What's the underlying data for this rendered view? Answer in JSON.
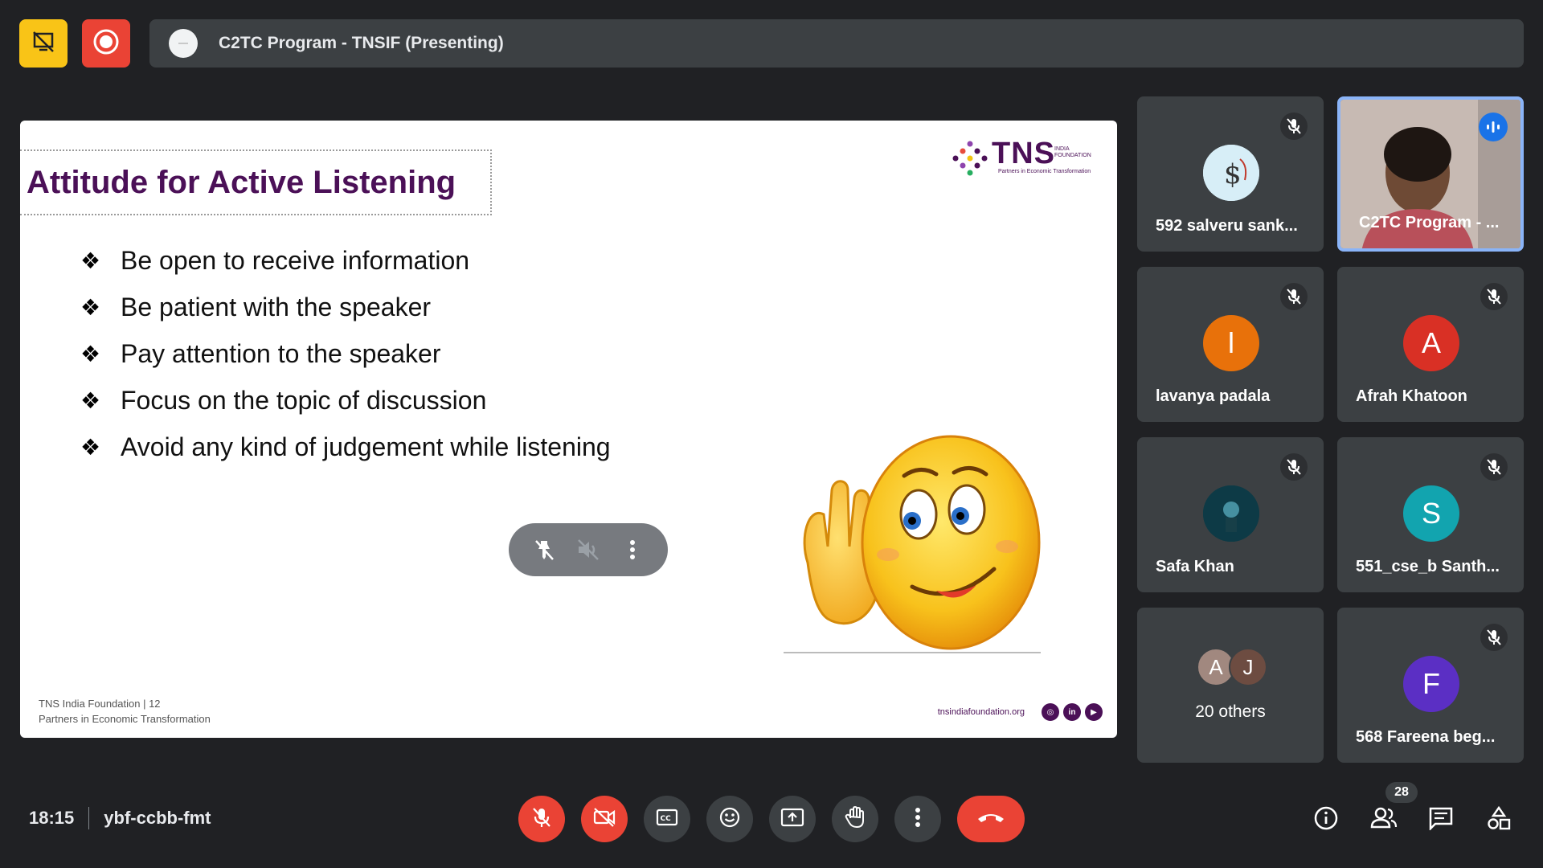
{
  "top": {
    "layout_button_icon": "no-presentation-icon",
    "record_button_icon": "recording-icon",
    "title": "C2TC Program - TNSIF (Presenting)"
  },
  "slide": {
    "title": "Attitude for Active Listening",
    "logo_word": "TNS",
    "logo_sub1": "INDIA FOUNDATION",
    "logo_sub2": "Partners in Economic Transformation",
    "bullets": [
      "Be open to receive information",
      "Be patient with the speaker",
      "Pay attention to the speaker",
      "Focus on the topic of discussion",
      "Avoid any kind of judgement while listening"
    ],
    "footer_line1": "TNS India Foundation | 12",
    "footer_line2": "Partners in Economic Transformation",
    "footer_url": "tnsindiafoundation.org"
  },
  "overlay": {
    "pin_icon": "unpin-icon",
    "mute_icon": "volume-off-icon",
    "more_icon": "more-vert-icon"
  },
  "participants": [
    {
      "name": "592 salveru sank...",
      "avatar": "S",
      "muted": true
    },
    {
      "name": "C2TC Program - ...",
      "speaking": true
    },
    {
      "name": "lavanya padala",
      "avatar": "l",
      "color": "#e8710a",
      "muted": true
    },
    {
      "name": "Afrah Khatoon",
      "avatar": "A",
      "color": "#d93025",
      "muted": true
    },
    {
      "name": "Safa Khan",
      "muted": true
    },
    {
      "name": "551_cse_b Santh...",
      "avatar": "S",
      "color": "#12a4af",
      "muted": true
    },
    {
      "others_label": "20 others",
      "others_avatars": [
        "A",
        "J"
      ]
    },
    {
      "name": "568 Fareena beg...",
      "avatar": "F",
      "color": "#5b2fc4",
      "muted": true
    }
  ],
  "bottom": {
    "time": "18:15",
    "meeting_code": "ybf-ccbb-fmt",
    "people_count": "28"
  },
  "colors": {
    "background": "#202124",
    "tile": "#3c4043",
    "danger": "#ea4335",
    "accent": "#1a73e8",
    "brand": "#4b1057"
  }
}
